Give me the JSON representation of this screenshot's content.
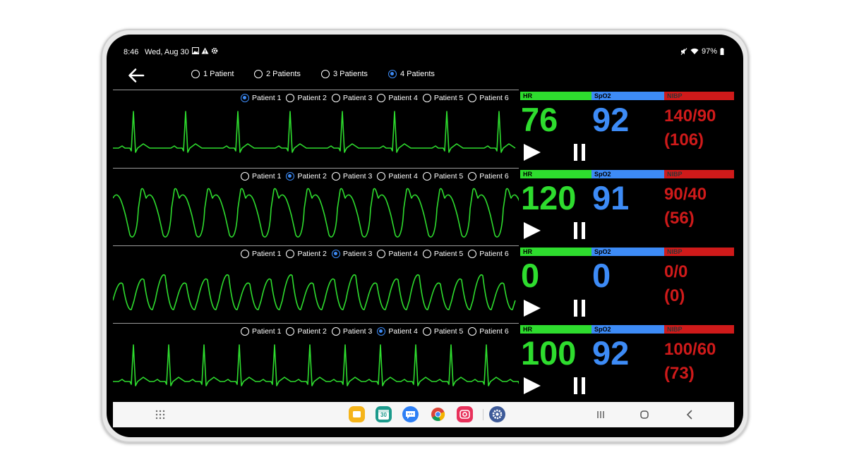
{
  "status_bar": {
    "time": "8:46",
    "date": "Wed, Aug 30",
    "battery": "97%"
  },
  "patient_count_options": [
    {
      "label": "1 Patient",
      "selected": false
    },
    {
      "label": "2 Patients",
      "selected": false
    },
    {
      "label": "3 Patients",
      "selected": false
    },
    {
      "label": "4 Patients",
      "selected": true
    }
  ],
  "patient_tab_labels": [
    "Patient 1",
    "Patient 2",
    "Patient 3",
    "Patient 4",
    "Patient 5",
    "Patient 6"
  ],
  "vital_headers": {
    "hr": "HR",
    "spo2": "SpO2",
    "nibp": "NIBP"
  },
  "monitors": [
    {
      "selected_patient": "Patient 1",
      "hr": "76",
      "spo2": "92",
      "nibp": "140/90",
      "map": "(106)",
      "rhythm": "sinus"
    },
    {
      "selected_patient": "Patient 2",
      "hr": "120",
      "spo2": "91",
      "nibp": "90/40",
      "map": "(56)",
      "rhythm": "vtach"
    },
    {
      "selected_patient": "Patient 3",
      "hr": "0",
      "spo2": "0",
      "nibp": "0/0",
      "map": "(0)",
      "rhythm": "vfib"
    },
    {
      "selected_patient": "Patient 4",
      "hr": "100",
      "spo2": "92",
      "nibp": "100/60",
      "map": "(73)",
      "rhythm": "sinus-fast"
    }
  ],
  "dock_apps": [
    "folder-app",
    "calendar-app",
    "messages-app",
    "chrome-app",
    "camera-app",
    "settings-app"
  ],
  "calendar_day": "30",
  "colors": {
    "hr": "#2edc2e",
    "spo2": "#3d8bf6",
    "nibp": "#cf1a1a",
    "wave": "#2edc2e"
  }
}
